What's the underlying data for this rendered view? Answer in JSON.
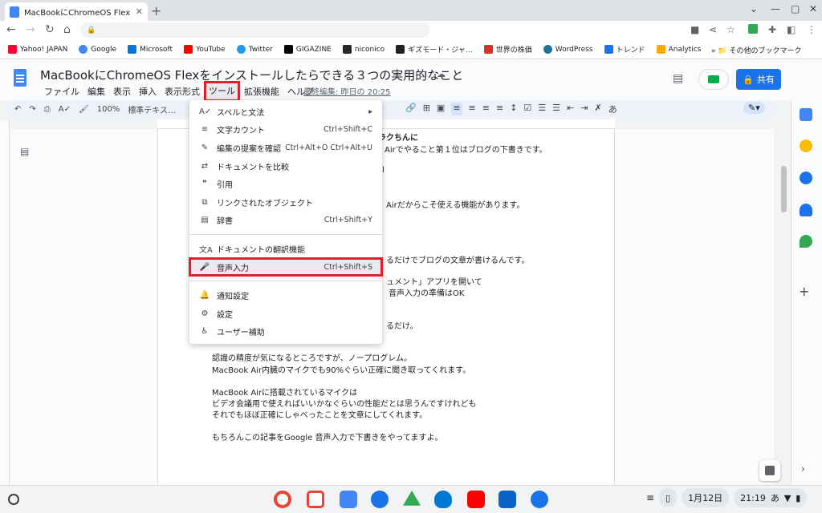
{
  "browser": {
    "tab_title": "MacBookにChromeOS Flexを…",
    "new_tab_symbol": "+",
    "bookmarks": [
      {
        "label": "Yahoo! JAPAN",
        "color": "#ff0033"
      },
      {
        "label": "Google",
        "color": "#4285f4"
      },
      {
        "label": "Microsoft",
        "color": "#0078d4"
      },
      {
        "label": "YouTube",
        "color": "#ff0000"
      },
      {
        "label": "Twitter",
        "color": "#1d9bf0"
      },
      {
        "label": "GIGAZINE",
        "color": "#000000"
      },
      {
        "label": "niconico",
        "color": "#252525"
      },
      {
        "label": "ギズモード・ジャ…",
        "color": "#222222"
      },
      {
        "label": "世界の株価",
        "color": "#d93025"
      },
      {
        "label": "WordPress",
        "color": "#21759b"
      },
      {
        "label": "トレンド",
        "color": "#1a73e8"
      },
      {
        "label": "Analytics",
        "color": "#f9ab00"
      }
    ],
    "other_bookmarks": "その他のブックマーク"
  },
  "docs": {
    "title": "MacBookにChromeOS Flexをインストールしたらできる３つの実用的なこと",
    "menus": [
      "ファイル",
      "編集",
      "表示",
      "挿入",
      "表示形式",
      "ツール",
      "拡張機能",
      "ヘルプ"
    ],
    "last_edit": "最終編集: 昨日の 20:25",
    "share_label": "共有",
    "zoom": "100%",
    "style": "標準テキス…",
    "input_tool": "あ"
  },
  "tools_menu": [
    {
      "icon": "A✓",
      "name": "spelling-grammar",
      "label": "スペルと文法",
      "shortcut": "▸"
    },
    {
      "icon": "≡",
      "name": "word-count",
      "label": "文字カウント",
      "shortcut": "Ctrl+Shift+C"
    },
    {
      "icon": "✎",
      "name": "review-suggestions",
      "label": "編集の提案を確認",
      "shortcut": "Ctrl+Alt+O Ctrl+Alt+U"
    },
    {
      "icon": "⇄",
      "name": "compare-documents",
      "label": "ドキュメントを比較",
      "shortcut": ""
    },
    {
      "icon": "❞",
      "name": "citations",
      "label": "引用",
      "shortcut": ""
    },
    {
      "icon": "⧉",
      "name": "linked-objects",
      "label": "リンクされたオブジェクト",
      "shortcut": ""
    },
    {
      "icon": "▤",
      "name": "dictionary",
      "label": "辞書",
      "shortcut": "Ctrl+Shift+Y"
    },
    {
      "icon": "文A",
      "name": "translate-document",
      "label": "ドキュメントの翻訳機能",
      "shortcut": ""
    },
    {
      "icon": "🎤",
      "name": "voice-typing",
      "label": "音声入力",
      "shortcut": "Ctrl+Shift+S"
    },
    {
      "icon": "🔔",
      "name": "notification-settings",
      "label": "通知設定",
      "shortcut": ""
    },
    {
      "icon": "⚙",
      "name": "preferences",
      "label": "設定",
      "shortcut": ""
    },
    {
      "icon": "♿",
      "name": "accessibility",
      "label": "ユーザー補助",
      "shortcut": ""
    }
  ],
  "document_lines": [
    {
      "text": "下書きがラクちんに",
      "bold": true
    },
    {
      "text": "Airでやること第１位はブログの下書きです。",
      "bold": false
    },
    {
      "text": "l",
      "bold": false
    },
    {
      "text": "Airだからこそ使える機能があります。",
      "bold": false
    },
    {
      "text": "るだけでブログの文章が書けるんです。",
      "bold": false
    },
    {
      "text": "ュメント」アプリを開いて",
      "bold": false
    },
    {
      "text": "音声入力の準備はOK",
      "bold": false
    },
    {
      "text": "るだけ。",
      "bold": false
    },
    {
      "text": "認識の精度が気になるところですが、ノープログレム。",
      "bold": false
    },
    {
      "text": "MacBook Air内臓のマイクでも90%ぐらい正確に聞き取ってくれます。",
      "bold": false
    },
    {
      "text": "MacBook Airに搭載されているマイクは",
      "bold": false
    },
    {
      "text": "ビデオ会議用で使えればいいかなぐらいの性能だとは思うんですけれども",
      "bold": false
    },
    {
      "text": "それでもほぼ正確にしゃべったことを文章にしてくれます。",
      "bold": false
    },
    {
      "text": "もちろんこの記事をGoogle 音声入力で下書きをやってますよ。",
      "bold": false
    }
  ],
  "shelf": {
    "date": "1月12日",
    "time": "21:19",
    "ime": "あ"
  }
}
